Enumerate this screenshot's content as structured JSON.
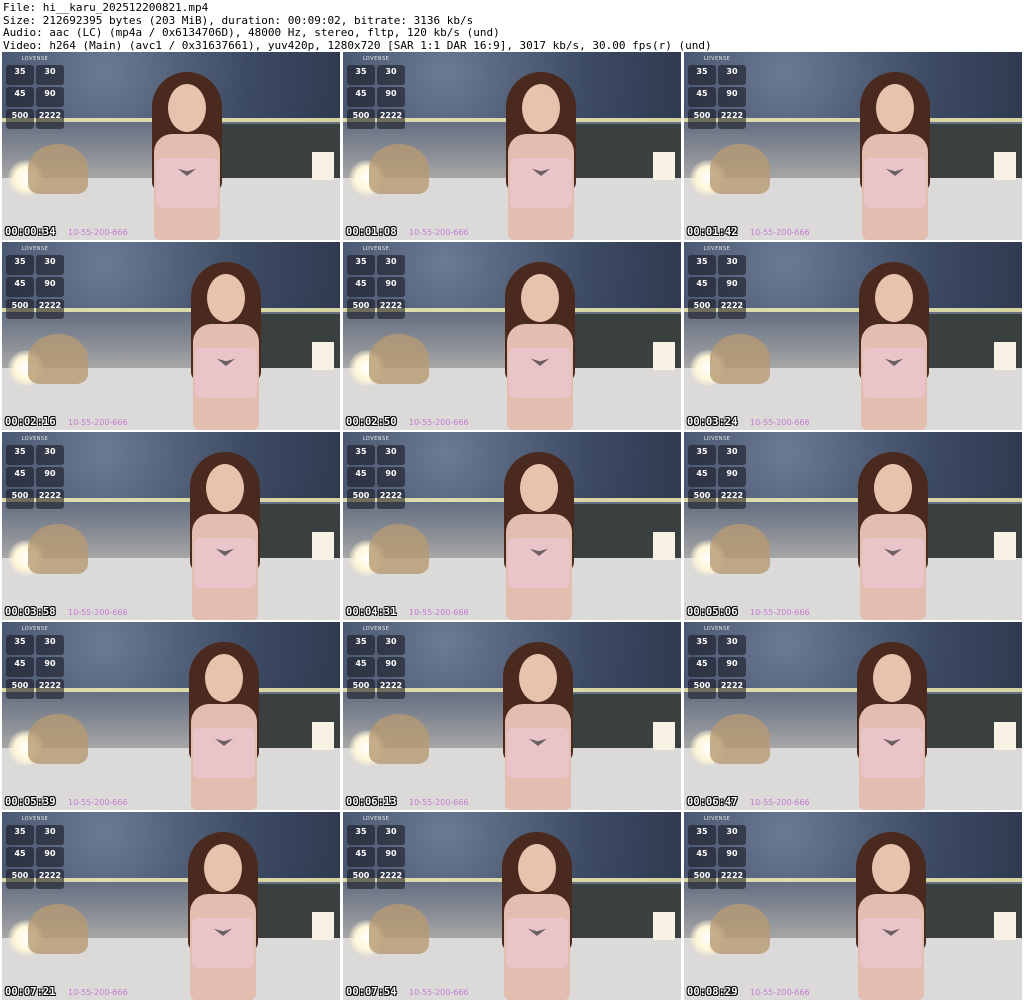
{
  "header": {
    "lines": [
      "File: hi__karu_202512200821.mp4",
      "Size: 212692395 bytes (203 MiB), duration: 00:09:02, bitrate: 3136 kb/s",
      "Audio: aac (LC) (mp4a / 0x6134706D), 48000 Hz, stereo, fltp, 120 kb/s (und)",
      "Video: h264 (Main) (avc1 / 0x31637661), yuv420p, 1280x720 [SAR 1:1 DAR 16:9], 3017 kb/s, 30.00 fps(r) (und)"
    ]
  },
  "thumbnails": [
    {
      "timestamp": "00:00:34",
      "watermark": "10-55-200-666"
    },
    {
      "timestamp": "00:01:08",
      "watermark": "10-55-200-666"
    },
    {
      "timestamp": "00:01:42",
      "watermark": "10-55-200-666"
    },
    {
      "timestamp": "00:02:16",
      "watermark": "10-55-200-666"
    },
    {
      "timestamp": "00:02:50",
      "watermark": "10-55-200-666"
    },
    {
      "timestamp": "00:03:24",
      "watermark": "10-55-200-666"
    },
    {
      "timestamp": "00:03:58",
      "watermark": "10-55-200-666"
    },
    {
      "timestamp": "00:04:31",
      "watermark": "10-55-200-666"
    },
    {
      "timestamp": "00:05:06",
      "watermark": "10-55-200-666"
    },
    {
      "timestamp": "00:05:39",
      "watermark": "10-55-200-666"
    },
    {
      "timestamp": "00:06:13",
      "watermark": "10-55-200-666"
    },
    {
      "timestamp": "00:06:47",
      "watermark": "10-55-200-666"
    },
    {
      "timestamp": "00:07:21",
      "watermark": "10-55-200-666"
    },
    {
      "timestamp": "00:07:54",
      "watermark": "10-55-200-666"
    },
    {
      "timestamp": "00:08:29",
      "watermark": "10-55-200-666"
    }
  ],
  "overlay": {
    "brand": "LOVENSE",
    "cells": [
      "35",
      "30",
      "45",
      "90",
      "500",
      "2222"
    ]
  }
}
